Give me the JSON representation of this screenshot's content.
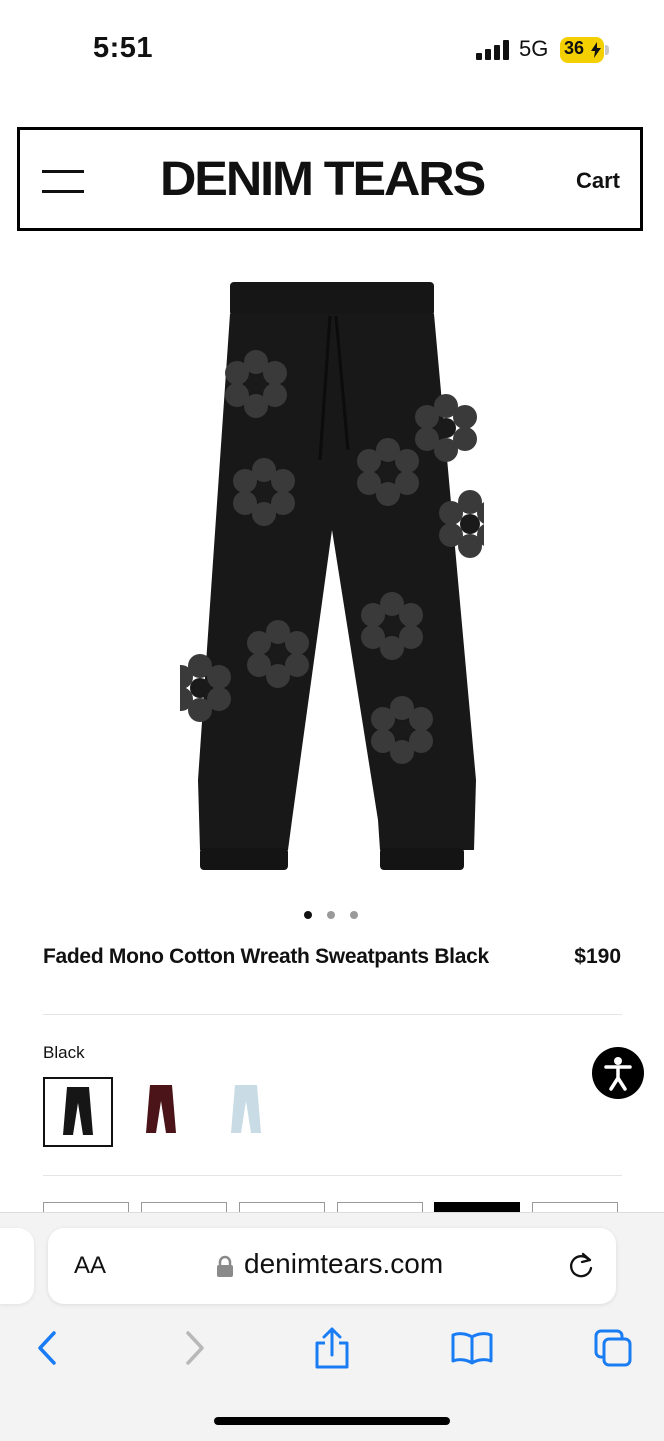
{
  "status_bar": {
    "time": "5:51",
    "network": "5G",
    "battery": "36"
  },
  "header": {
    "logo": "DENIM TEARS",
    "cart": "Cart"
  },
  "product": {
    "title": "Faded Mono Cotton Wreath Sweatpants Black",
    "price": "$190",
    "color_label": "Black",
    "image_count": 3,
    "active_image": 1,
    "swatches": [
      {
        "name": "Black",
        "color": "#161616",
        "selected": true
      },
      {
        "name": "Burgundy",
        "color": "#4a1419",
        "selected": false
      },
      {
        "name": "Light Blue",
        "color": "#c9dbe4",
        "selected": false
      }
    ]
  },
  "browser": {
    "text_size": "AA",
    "url": "denimtears.com"
  },
  "colors": {
    "accent": "#000000",
    "link_blue": "#1a7cf5",
    "disabled": "#b8b8b8"
  }
}
